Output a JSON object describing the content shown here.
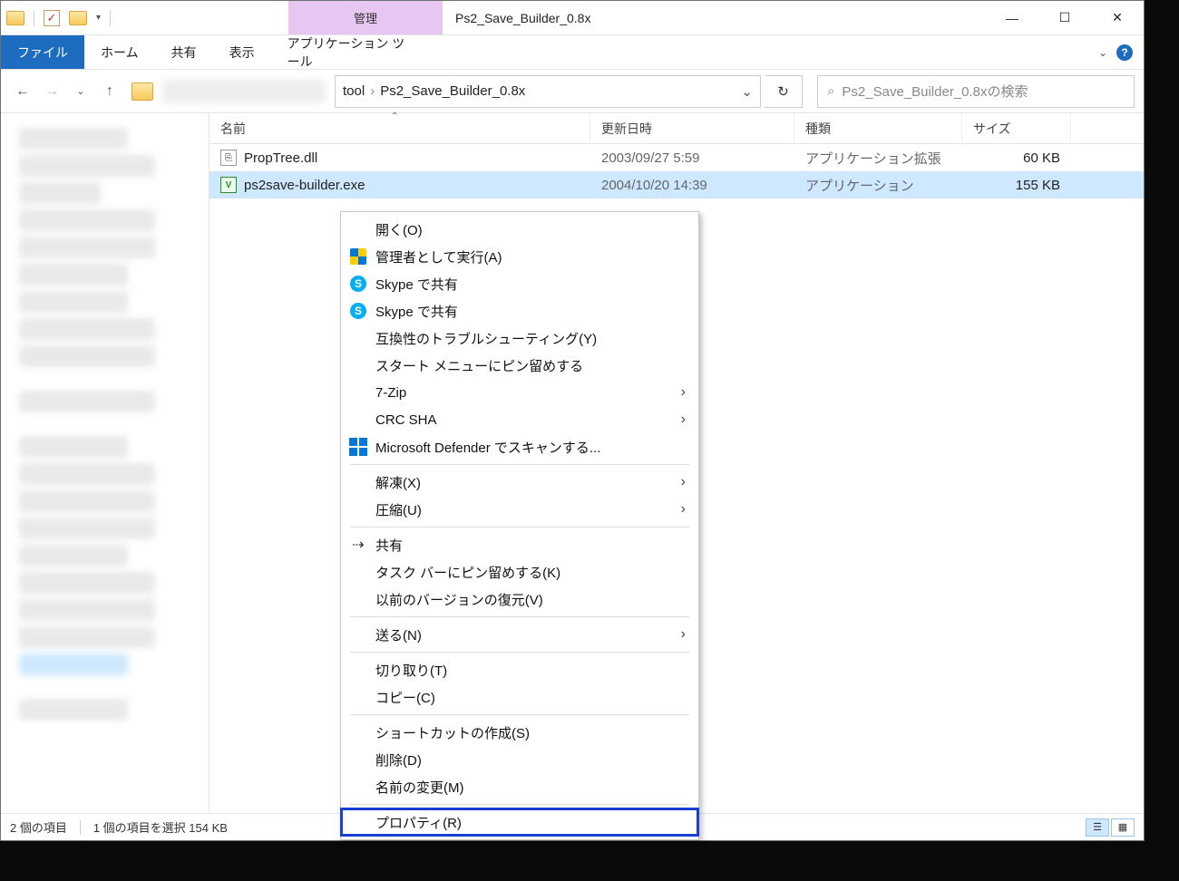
{
  "titlebar": {
    "context_tab": "管理",
    "title": "Ps2_Save_Builder_0.8x"
  },
  "ribbon": {
    "file": "ファイル",
    "home": "ホーム",
    "share": "共有",
    "view": "表示",
    "app_tools": "アプリケーション ツール"
  },
  "address": {
    "seg1": "tool",
    "seg2": "Ps2_Save_Builder_0.8x"
  },
  "search": {
    "placeholder": "Ps2_Save_Builder_0.8xの検索"
  },
  "columns": {
    "name": "名前",
    "date": "更新日時",
    "type": "種類",
    "size": "サイズ"
  },
  "rows": [
    {
      "name": "PropTree.dll",
      "date": "2003/09/27 5:59",
      "type": "アプリケーション拡張",
      "size": "60 KB",
      "icon": "dll"
    },
    {
      "name": "ps2save-builder.exe",
      "date": "2004/10/20 14:39",
      "type": "アプリケーション",
      "size": "155 KB",
      "icon": "exe",
      "selected": true
    }
  ],
  "ctx": {
    "open": "開く(O)",
    "run_admin": "管理者として実行(A)",
    "skype1": "Skype で共有",
    "skype2": "Skype で共有",
    "compat": "互換性のトラブルシューティング(Y)",
    "pin_start": "スタート メニューにピン留めする",
    "sevenzip": "7-Zip",
    "crcsha": "CRC SHA",
    "defender": "Microsoft Defender でスキャンする...",
    "extract": "解凍(X)",
    "compress": "圧縮(U)",
    "share": "共有",
    "pin_taskbar": "タスク バーにピン留めする(K)",
    "restore_prev": "以前のバージョンの復元(V)",
    "send_to": "送る(N)",
    "cut": "切り取り(T)",
    "copy": "コピー(C)",
    "shortcut": "ショートカットの作成(S)",
    "delete": "削除(D)",
    "rename": "名前の変更(M)",
    "properties": "プロパティ(R)"
  },
  "status": {
    "count": "2 個の項目",
    "selection": "1 個の項目を選択 154 KB"
  }
}
